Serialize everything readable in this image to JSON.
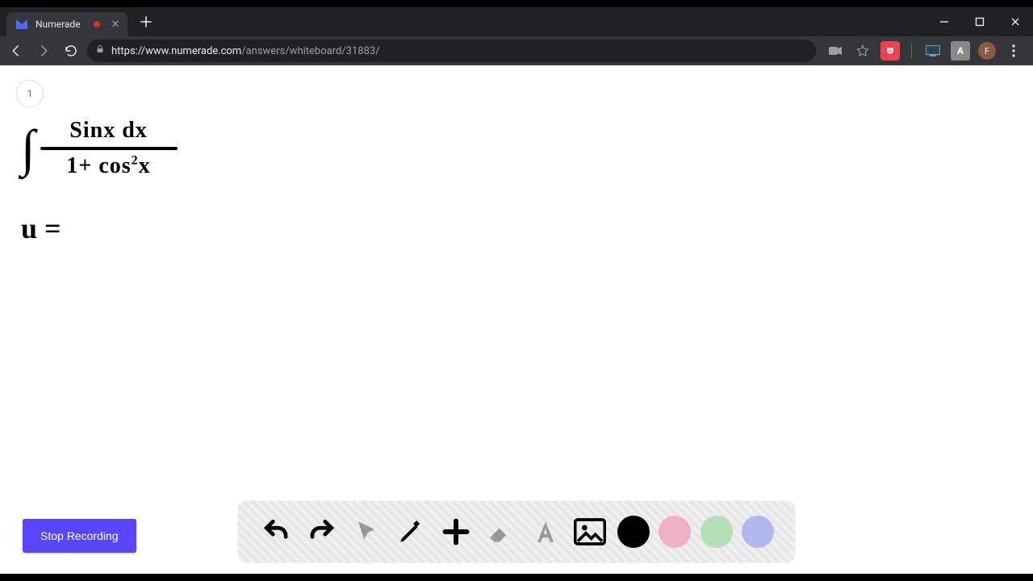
{
  "browser": {
    "tab": {
      "title": "Numerade",
      "recording": true
    },
    "url_host": "https://www.numerade.com",
    "url_path": "/answers/whiteboard/31883/",
    "avatar_initial": "F"
  },
  "page": {
    "number": "1",
    "handwriting": {
      "integral_sign": "∫",
      "numerator": "Sinx dx",
      "denom_left": "1+ cos",
      "denom_sup": "2",
      "denom_right": "x",
      "usub": "u ="
    },
    "stop_button": "Stop Recording"
  },
  "toolbar": {
    "tools": {
      "undo": "undo",
      "redo": "redo",
      "pointer": "pointer",
      "pen": "pen",
      "add": "add",
      "eraser": "eraser",
      "text": "text",
      "image": "image"
    },
    "colors": {
      "black": "#000000",
      "pink": "#f0b0c6",
      "green": "#b4e0b8",
      "blue": "#b0b8ef"
    }
  }
}
